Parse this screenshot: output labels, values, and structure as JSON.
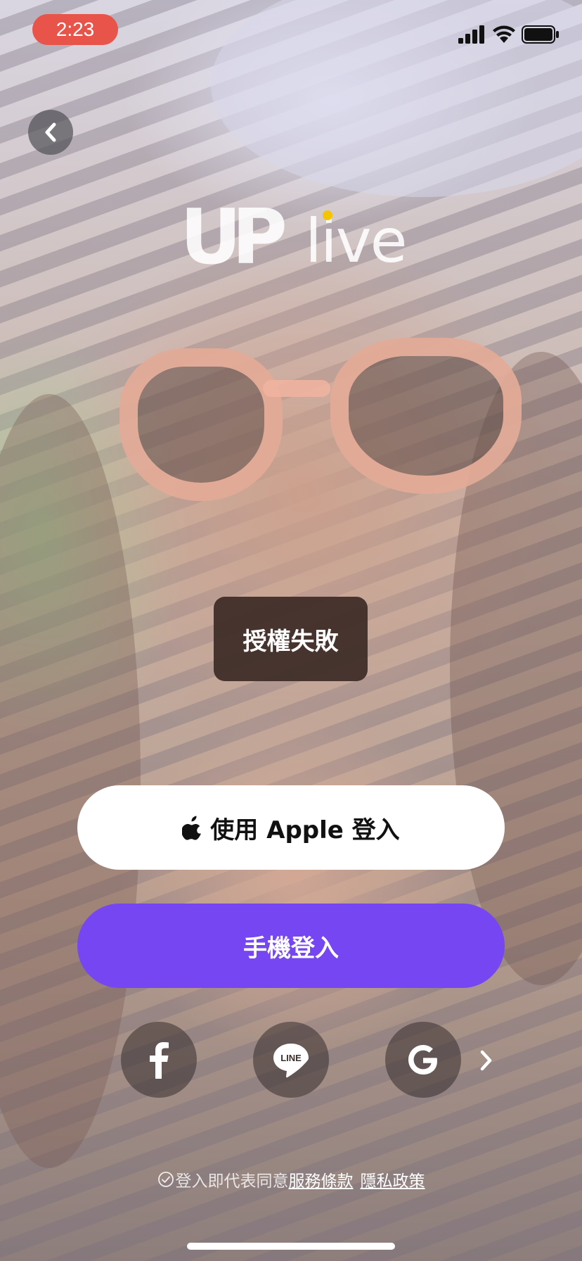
{
  "status_bar": {
    "time": "2:23",
    "time_pill_color": "#e8534a",
    "icons": [
      "signal-icon",
      "wifi-icon",
      "battery-icon"
    ]
  },
  "header": {
    "back_icon": "chevron-left-icon"
  },
  "logo": {
    "brand": "UPlive",
    "mark_text": "UP",
    "word_text": "live",
    "dot_color": "#f5c400"
  },
  "toast": {
    "message": "授權失敗"
  },
  "buttons": {
    "apple_label": "使用 Apple 登入",
    "phone_label": "手機登入",
    "phone_color": "#7646f2"
  },
  "social": {
    "items": [
      {
        "name": "Facebook",
        "icon": "facebook-icon"
      },
      {
        "name": "LINE",
        "icon": "line-icon",
        "icon_text": "LINE"
      },
      {
        "name": "Google",
        "icon": "google-icon"
      }
    ],
    "more_icon": "chevron-right-icon"
  },
  "terms": {
    "prefix": "登入即代表同意",
    "service_link": "服務條款",
    "privacy_link": "隱私政策"
  }
}
